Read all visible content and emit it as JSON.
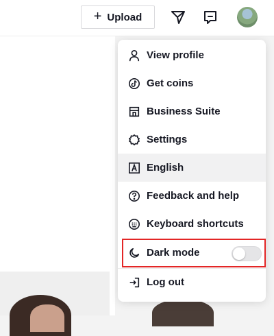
{
  "topbar": {
    "upload_label": "Upload",
    "upload_icon": "plus-icon",
    "inbox_icon": "send-icon",
    "messages_icon": "message-icon",
    "avatar_icon": "avatar"
  },
  "menu": {
    "items": [
      {
        "label": "View profile",
        "icon": "person-icon"
      },
      {
        "label": "Get coins",
        "icon": "coin-icon"
      },
      {
        "label": "Business Suite",
        "icon": "store-icon"
      },
      {
        "label": "Settings",
        "icon": "gear-icon"
      },
      {
        "label": "English",
        "icon": "language-icon"
      },
      {
        "label": "Feedback and help",
        "icon": "help-icon"
      },
      {
        "label": "Keyboard shortcuts",
        "icon": "keyboard-icon"
      },
      {
        "label": "Dark mode",
        "icon": "moon-icon",
        "toggle_on": false
      },
      {
        "label": "Log out",
        "icon": "logout-icon"
      }
    ]
  },
  "colors": {
    "highlight": "#e32626",
    "text": "#161823"
  }
}
